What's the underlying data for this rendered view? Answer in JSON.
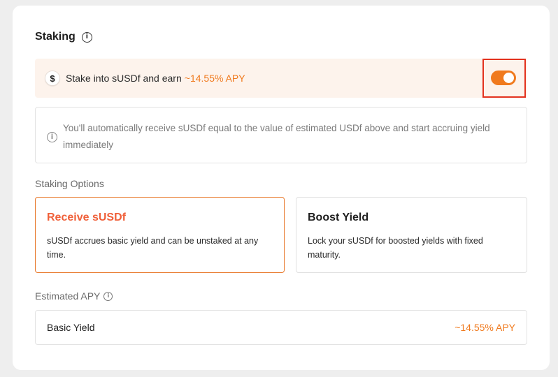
{
  "staking": {
    "title": "Staking",
    "banner": {
      "text": "Stake into sUSDf and earn",
      "apy": "~14.55% APY",
      "toggle_on": true
    },
    "notice": "You'll automatically receive sUSDf equal to the value of estimated USDf above and start accruing yield immediately",
    "options_label": "Staking Options",
    "options": [
      {
        "title": "Receive sUSDf",
        "description": "sUSDf accrues basic yield and can be unstaked at any time.",
        "selected": true
      },
      {
        "title": "Boost Yield",
        "description": "Lock your sUSDf for boosted yields with fixed maturity.",
        "selected": false
      }
    ],
    "estimated_label": "Estimated APY",
    "estimated": {
      "label": "Basic Yield",
      "value": "~14.55% APY"
    }
  },
  "colors": {
    "accent": "#f07a1e",
    "selected_title": "#f0603a",
    "banner_bg": "#fdf3ec",
    "highlight_box": "#e3321e"
  },
  "icons": {
    "title_info": "info-icon",
    "banner": "dollar-icon",
    "notice_info": "info-icon",
    "estimated_info": "info-icon"
  }
}
